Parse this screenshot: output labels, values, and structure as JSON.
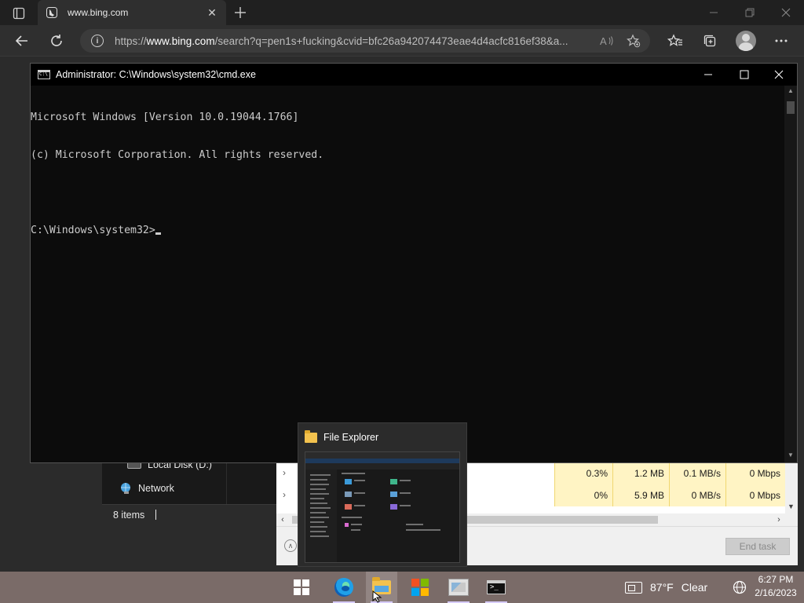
{
  "browser": {
    "tab_title": "www.bing.com",
    "url_prefix": "https://",
    "url_host": "www.bing.com",
    "url_rest": "/search?q=pen1s+fucking&cvid=bfc26a942074473eae4d4acfc816ef38&a...",
    "read_aloud_label": "A"
  },
  "cmd": {
    "title": "Administrator: C:\\Windows\\system32\\cmd.exe",
    "lines": [
      "Microsoft Windows [Version 10.0.19044.1766]",
      "(c) Microsoft Corporation. All rights reserved.",
      "",
      "C:\\Windows\\system32>"
    ]
  },
  "explorer": {
    "drive_label": "Local Disk (D:)",
    "network_label": "Network",
    "status_items": "8 items"
  },
  "taskmgr": {
    "rows": [
      {
        "cpu": "0.3%",
        "memory": "1.2 MB",
        "disk": "0.1 MB/s",
        "network": "0 Mbps"
      },
      {
        "cpu": "0%",
        "memory": "5.9 MB",
        "disk": "0 MB/s",
        "network": "0 Mbps"
      }
    ],
    "end_task": "End task"
  },
  "thumbnail": {
    "title": "File Explorer"
  },
  "taskbar": {
    "temperature": "87°F",
    "condition": "Clear",
    "time": "6:27 PM",
    "date": "2/16/2023"
  },
  "colors": {
    "taskbar": "#7a6b68",
    "cmd_background": "#0c0c0c",
    "cmd_text": "#cccccc",
    "taskmgr_highlight": "#fff4c4"
  }
}
